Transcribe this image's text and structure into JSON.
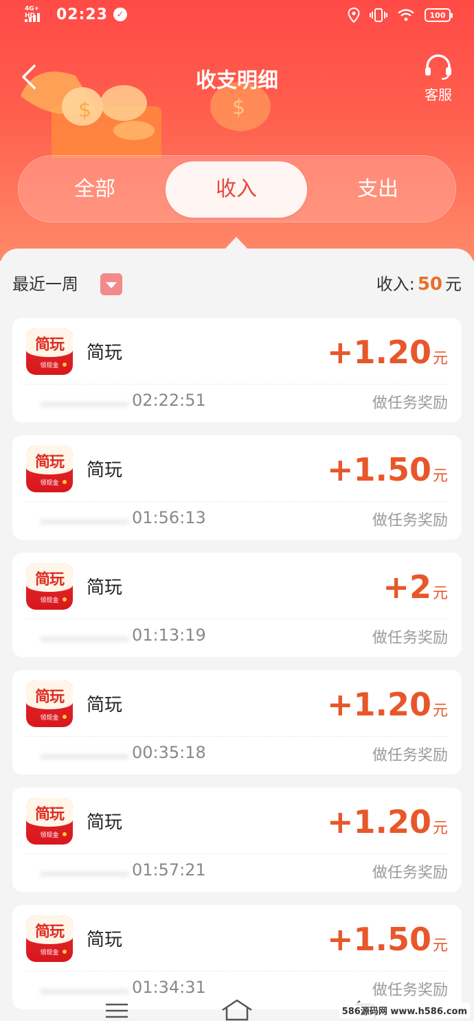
{
  "status_bar": {
    "network": "4G+ HD",
    "time": "02:23",
    "battery": "100"
  },
  "header": {
    "title": "收支明细",
    "service_label": "客服"
  },
  "tabs": [
    {
      "label": "全部",
      "active": false
    },
    {
      "label": "收入",
      "active": true
    },
    {
      "label": "支出",
      "active": false
    }
  ],
  "filter": {
    "period": "最近一周",
    "total_label": "收入:",
    "total_value": "50",
    "total_unit": "元"
  },
  "app_icon": {
    "title": "简玩",
    "subtitle": "领现金"
  },
  "records": [
    {
      "app": "简玩",
      "amount": "+1.20",
      "unit": "元",
      "time": "02:22:51",
      "reason": "做任务奖励"
    },
    {
      "app": "简玩",
      "amount": "+1.50",
      "unit": "元",
      "time": "01:56:13",
      "reason": "做任务奖励"
    },
    {
      "app": "简玩",
      "amount": "+2",
      "unit": "元",
      "time": "01:13:19",
      "reason": "做任务奖励"
    },
    {
      "app": "简玩",
      "amount": "+1.20",
      "unit": "元",
      "time": "00:35:18",
      "reason": "做任务奖励"
    },
    {
      "app": "简玩",
      "amount": "+1.20",
      "unit": "元",
      "time": "01:57:21",
      "reason": "做任务奖励"
    },
    {
      "app": "简玩",
      "amount": "+1.50",
      "unit": "元",
      "time": "01:34:31",
      "reason": "做任务奖励"
    }
  ],
  "watermark": "586源码网 www.h586.com",
  "colors": {
    "header_top": "#ff4a46",
    "header_bottom": "#ff8a6a",
    "amount": "#e8572a",
    "tab_active_text": "#e8463b"
  }
}
